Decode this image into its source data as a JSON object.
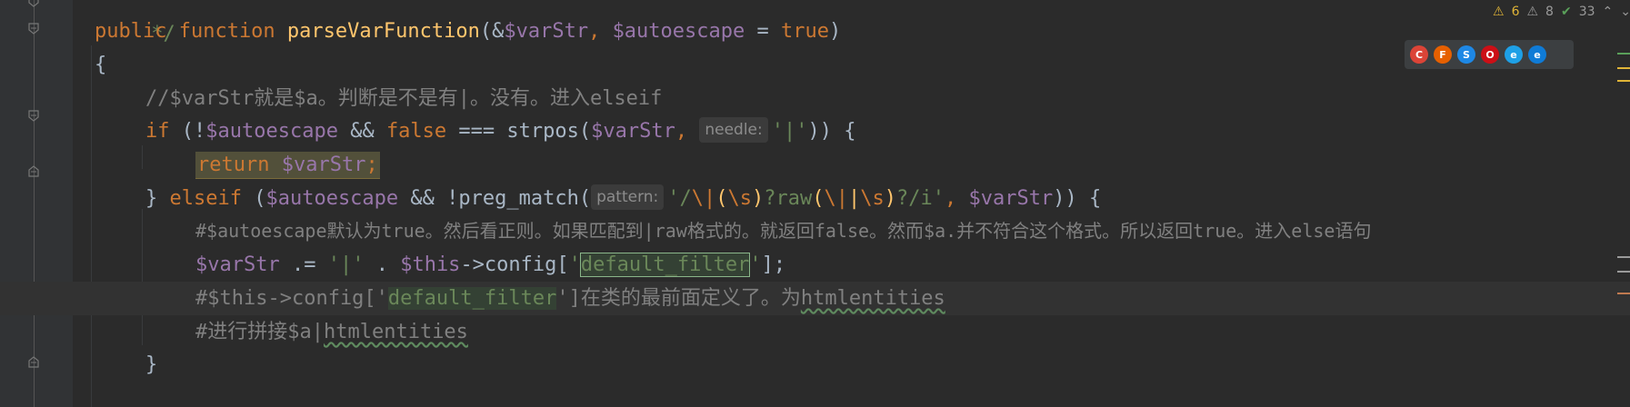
{
  "status": {
    "warnings": "6",
    "weak_warnings": "8",
    "typos": "33",
    "up_icon": "⌃",
    "down_icon": "⌄"
  },
  "browsers": [
    {
      "name": "chrome-icon",
      "letter": "C",
      "color": "#db4437"
    },
    {
      "name": "firefox-icon",
      "letter": "F",
      "color": "#e66000"
    },
    {
      "name": "safari-icon",
      "letter": "S",
      "color": "#1e88e5"
    },
    {
      "name": "opera-icon",
      "letter": "O",
      "color": "#cc0f16"
    },
    {
      "name": "ie-icon",
      "letter": "e",
      "color": "#1ea0e6"
    },
    {
      "name": "edge-icon",
      "letter": "e",
      "color": "#0f7bd6"
    }
  ],
  "code": {
    "l0": " */",
    "l1": {
      "kw": "public function ",
      "fn": "parseVarFunction",
      "p1": "(&",
      "v1": "$varStr",
      "p2": ", ",
      "v2": "$autoescape",
      "p3": " = ",
      "kw2": "true",
      "p4": ")"
    },
    "l2": "{",
    "l3": "//$varStr就是$a。判断是不是有|。没有。进入elseif",
    "l4": {
      "kw1": "if ",
      "p1": "(!",
      "v1": "$autoescape",
      "p2": " && ",
      "kw2": "false",
      "p3": " === strpos(",
      "v2": "$varStr",
      "p4": ", ",
      "hint": "needle:",
      "s1": "'|'",
      "p5": ")) {"
    },
    "l5": {
      "kw": "return ",
      "v": "$varStr",
      "semi": ";"
    },
    "l6": {
      "p1": "} ",
      "kw1": "elseif ",
      "p2": "(",
      "v1": "$autoescape",
      "p3": " && !preg_match(",
      "hint": "pattern:",
      "s1": "'/",
      "rx1": "\\|",
      "rx2": "(",
      "rx3": "\\s",
      "rx4": ")",
      "s2": "?raw",
      "rx5": "(",
      "rx6": "\\|",
      "rx7": "|",
      "rx8": "\\s",
      "rx9": ")",
      "s3": "?/i'",
      "p4": ", ",
      "v2": "$varStr",
      "p5": ")) {"
    },
    "l7": "#$autoescape默认为true。然后看正则。如果匹配到|raw格式的。就返回false。然而$a.并不符合这个格式。所以返回true。进入else语句",
    "l8": {
      "v1": "$varStr",
      "p1": " .= ",
      "s1": "'|'",
      "p2": " . ",
      "v2": "$this",
      "p3": "->config[",
      "s2": "'",
      "s3": "default_filter",
      "s4": "'",
      "p4": "];"
    },
    "l9": {
      "c1": "#$this->config['",
      "c2": "default_filter",
      "c3": "']在类的最前面定义了。为",
      "c4": "htmlentities"
    },
    "l10": {
      "c1": "#进行拼接$a|",
      "c2": "htmlentities"
    },
    "l11": "}"
  }
}
